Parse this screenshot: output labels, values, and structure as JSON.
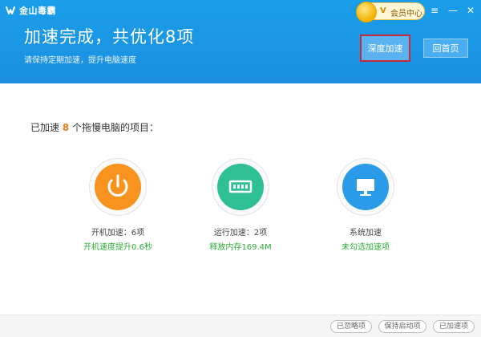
{
  "app": {
    "name": "金山毒霸"
  },
  "vip": {
    "label": "会员中心",
    "badge": "V"
  },
  "window": {
    "menu_icon": "≡",
    "minimize_icon": "—",
    "close_icon": "✕"
  },
  "header": {
    "title": "加速完成，共优化8项",
    "subtitle": "请保持定期加速，提升电脑速度",
    "deep_button": "深度加速",
    "home_button": "回首页"
  },
  "summary": {
    "prefix": "已加速",
    "count": "8",
    "suffix": "个拖慢电脑的项目："
  },
  "items": [
    {
      "icon": "power-icon",
      "color": "#f7931e",
      "label": "开机加速：6项",
      "sub": "开机速度提升0.6秒"
    },
    {
      "icon": "memory-icon",
      "color": "#2fbf94",
      "label": "运行加速：2项",
      "sub": "释放内存169.4M"
    },
    {
      "icon": "monitor-icon",
      "color": "#2a9be8",
      "label": "系统加速",
      "sub": "未勾选加速项"
    }
  ],
  "footer": {
    "ignored": "已忽略项",
    "startup": "保持启动项",
    "accelerated": "已加速项"
  }
}
